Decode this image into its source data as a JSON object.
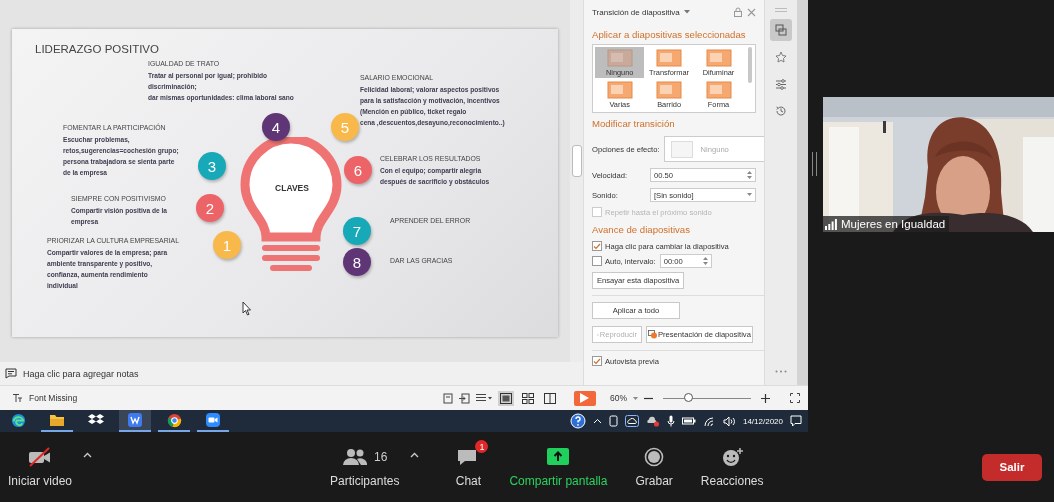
{
  "slide": {
    "title": "LIDERAZGO POSITIVO",
    "center_label": "CLAVES",
    "keys": [
      {
        "number": "4",
        "color": "#5f3576",
        "heading": "IGUALDAD DE TRATO",
        "lines": [
          "Tratar al personal por igual; prohibido",
          "discriminación;",
          "dar mismas oportunidades: clima laboral sano"
        ]
      },
      {
        "number": "5",
        "color": "#f9b94a",
        "heading": "SALARIO EMOCIONAL",
        "lines": [
          "Felicidad laboral; valorar  aspectos positivos",
          "para la satisfacción y motivación, incentivos",
          "(Mención en público, ticket regalo",
          "cena ,descuentos,desayuno,reconocimiento..)"
        ]
      },
      {
        "number": "3",
        "color": "#17a9b8",
        "heading": "FOMENTAR LA PARTICIPACIÓN",
        "lines": [
          "Escuchar problemas,",
          "retos,sugerencias=cochesión grupo;",
          "persona trabajadora se sienta parte",
          "de la empresa"
        ]
      },
      {
        "number": "6",
        "color": "#ec6467",
        "heading": "CELEBRAR LOS RESULTADOS",
        "lines": [
          "Con el equipo; compartir alegria",
          "después de sacrificio y obstáculos"
        ]
      },
      {
        "number": "2",
        "color": "#ec6467",
        "heading": "SIEMPRE CON POSITIVISMO",
        "lines": [
          "Compartir visión positiva de la",
          "empresa"
        ]
      },
      {
        "number": "7",
        "color": "#17a9b8",
        "heading": "APRENDER DEL ERROR"
      },
      {
        "number": "1",
        "color": "#f9b94a",
        "heading": "PRIORIZAR LA CULTURA EMPRESARIAL",
        "lines": [
          "Compartir valores de la empresa; para",
          "ambiente transparente y positivo,",
          "confianza, aumenta rendimiento",
          "individual"
        ]
      },
      {
        "number": "8",
        "color": "#5f3576",
        "heading": "DAR LAS GRACIAS"
      }
    ]
  },
  "notes_placeholder": "Haga clic para agregar notas",
  "panel": {
    "title": "Transición de diapositiva",
    "apply_heading": "Aplicar a diapositivas seleccionadas",
    "transitions": [
      {
        "label": "Ninguno",
        "selected": true
      },
      {
        "label": "Transformar",
        "selected": false
      },
      {
        "label": "Difuminar",
        "selected": false
      },
      {
        "label": "Varias",
        "selected": false
      },
      {
        "label": "Barrido",
        "selected": false
      },
      {
        "label": "Forma",
        "selected": false
      }
    ],
    "modify_heading": "Modificar transición",
    "effect_label": "Opciones de efecto:",
    "effect_value": "Ninguno",
    "speed_label": "Velocidad:",
    "speed_value": "00.50",
    "sound_label": "Sonido:",
    "sound_value": "[Sin sonido]",
    "repeat": {
      "label": "Repetir hasta el próximo sonido",
      "checked": false,
      "disabled": true
    },
    "advance_heading": "Avance de diapositivas",
    "on_click": {
      "label": "Haga clic para cambiar la diapositiva",
      "checked": true
    },
    "auto": {
      "label": "Auto, intervalo:",
      "checked": false
    },
    "interval_value": "00:00",
    "rehearse_button": "Ensayar esta diapositiva",
    "apply_all_button": "Aplicar a todo",
    "play_button": {
      "label": "Reproducir",
      "disabled": true
    },
    "slideshow_button": "Presentación de diapositiva",
    "autopreview": {
      "label": "Autovista previa",
      "checked": true
    }
  },
  "side_tools": [
    {
      "kind": "transition",
      "selected": true
    },
    {
      "kind": "animation",
      "selected": false
    },
    {
      "kind": "properties",
      "selected": false
    },
    {
      "kind": "history",
      "selected": false
    }
  ],
  "status_bar": {
    "font_notice": "Font Missing",
    "views": [
      {
        "kind": "normal",
        "selected": true
      },
      {
        "kind": "sorter",
        "selected": false
      },
      {
        "kind": "reading",
        "selected": false
      }
    ],
    "zoom": "60%",
    "level": 0.3
  },
  "taskbar": {
    "apps": [
      {
        "kind": "edge",
        "running": false,
        "selected": false
      },
      {
        "kind": "explorer",
        "running": true,
        "selected": false
      },
      {
        "kind": "dropbox",
        "running": false,
        "selected": false
      },
      {
        "kind": "writer",
        "running": true,
        "selected": true
      },
      {
        "kind": "chrome",
        "running": true,
        "selected": false
      },
      {
        "kind": "zoom",
        "running": true,
        "selected": false
      }
    ],
    "date": "14/12/2020"
  },
  "video": {
    "name": "Mujeres en Igualdad"
  },
  "toolbar": {
    "items": [
      {
        "kind": "video",
        "label": "Iniciar video",
        "menu": true,
        "muted": true
      },
      {
        "kind": "participants",
        "label": "Participantes",
        "count": "16",
        "menu": true
      },
      {
        "kind": "chat",
        "label": "Chat",
        "badge": "1",
        "menu": false
      },
      {
        "kind": "share",
        "label": "Compartir pantalla",
        "menu": false
      },
      {
        "kind": "record",
        "label": "Grabar",
        "menu": false
      },
      {
        "kind": "reactions",
        "label": "Reacciones",
        "menu": false
      }
    ],
    "leave_button": "Salir"
  }
}
